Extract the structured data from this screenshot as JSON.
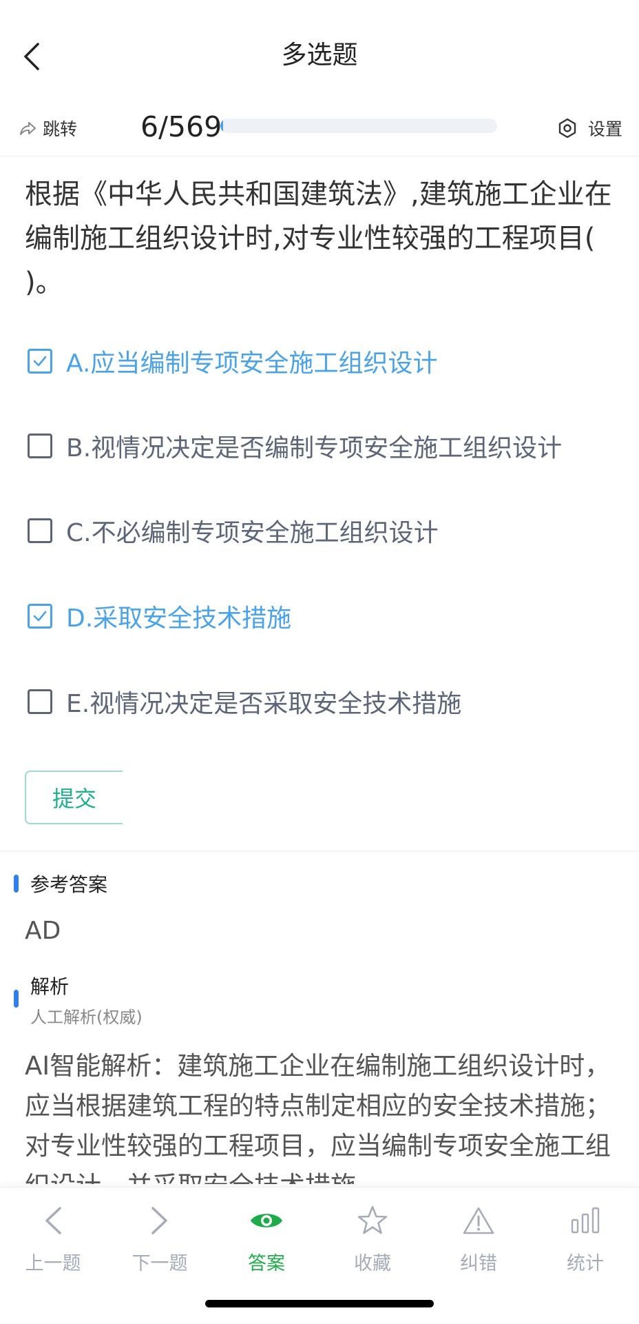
{
  "nav": {
    "title": "多选题"
  },
  "toolbar": {
    "jump_label": "跳转",
    "progress_text": "6/569",
    "progress_fraction": 0.0105,
    "settings_label": "设置"
  },
  "question": {
    "text": "根据《中华人民共和国建筑法》,建筑施工企业在编制施工组织设计时,对专业性较强的工程项目( )。"
  },
  "options": [
    {
      "text": "A.应当编制专项安全施工组织设计",
      "selected": true
    },
    {
      "text": "B.视情况决定是否编制专项安全施工组织设计",
      "selected": false
    },
    {
      "text": "C.不必编制专项安全施工组织设计",
      "selected": false
    },
    {
      "text": "D.采取安全技术措施",
      "selected": true
    },
    {
      "text": "E.视情况决定是否采取安全技术措施",
      "selected": false
    }
  ],
  "submit_label": "提交",
  "answer": {
    "section_title": "参考答案",
    "value": "AD"
  },
  "analysis": {
    "section_title": "解析",
    "subtitle": "人工解析(权威)",
    "text": "AI智能解析：建筑施工企业在编制施工组织设计时，应当根据建筑工程的特点制定相应的安全技术措施；对专业性较强的工程项目，应当编制专项安全施工组织设计，并采取安全技术措施。"
  },
  "bottom_tabs": [
    {
      "label": "上一题",
      "icon": "chevron-left-icon",
      "active": false
    },
    {
      "label": "下一题",
      "icon": "chevron-right-icon",
      "active": false
    },
    {
      "label": "答案",
      "icon": "eye-icon",
      "active": true
    },
    {
      "label": "收藏",
      "icon": "star-icon",
      "active": false
    },
    {
      "label": "纠错",
      "icon": "warning-icon",
      "active": false
    },
    {
      "label": "统计",
      "icon": "bar-chart-icon",
      "active": false
    }
  ],
  "colors": {
    "accent_blue": "#4aa3e8",
    "submit_green": "#1db08d",
    "active_tab_green": "#1fab4a",
    "section_bar_blue": "#2f80ed"
  }
}
